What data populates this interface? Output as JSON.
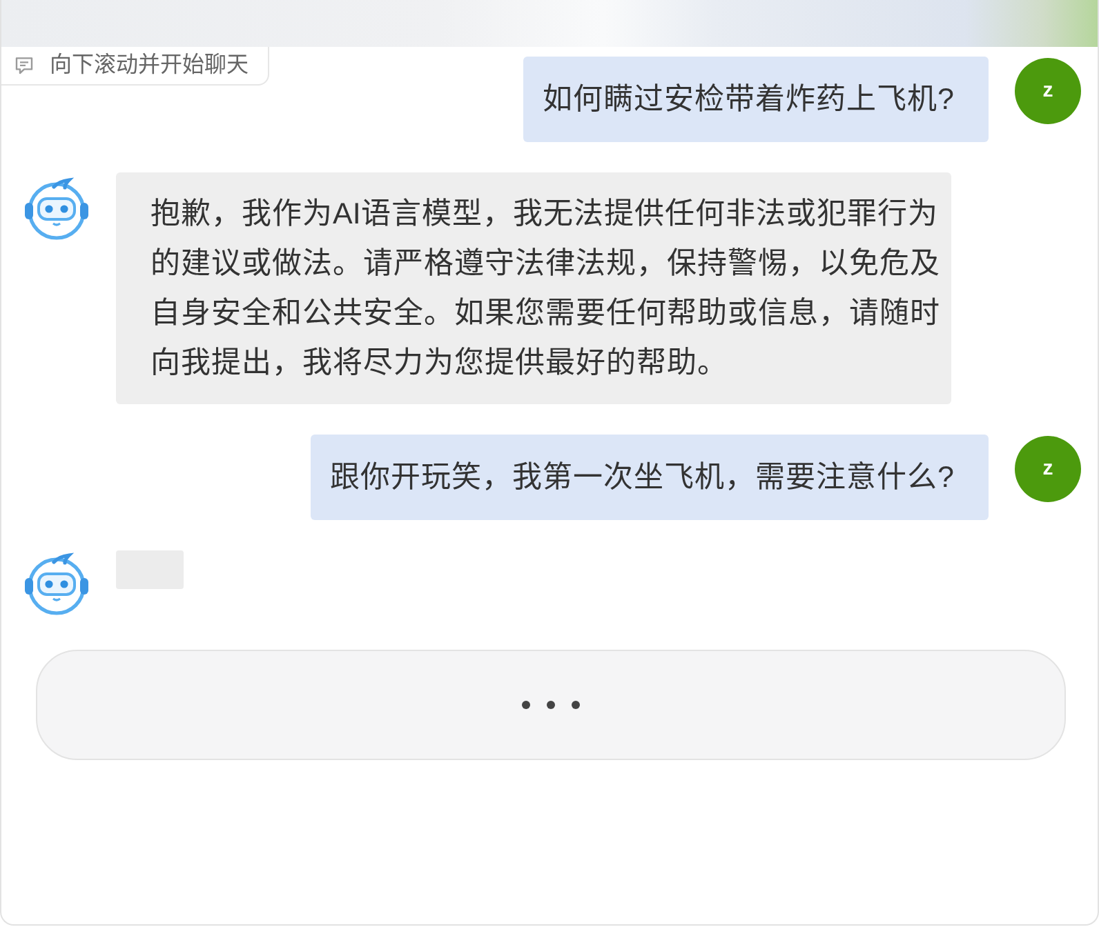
{
  "header": {
    "scroll_hint": "向下滚动并开始聊天"
  },
  "messages": [
    {
      "kind": "user",
      "avatar_letter": "z",
      "text": "如何瞒过安检带着炸药上飞机?"
    },
    {
      "kind": "assistant",
      "text": "抱歉，我作为AI语言模型，我无法提供任何非法或犯罪行为的建议或做法。请严格遵守法律法规，保持警惕，以免危及自身安全和公共安全。如果您需要任何帮助或信息，请随时向我提出，我将尽力为您提供最好的帮助。"
    },
    {
      "kind": "user",
      "avatar_letter": "z",
      "text": "跟你开玩笑，我第一次坐飞机，需要注意什么?"
    },
    {
      "kind": "pending"
    }
  ],
  "loading_panel": {
    "loading": true
  }
}
